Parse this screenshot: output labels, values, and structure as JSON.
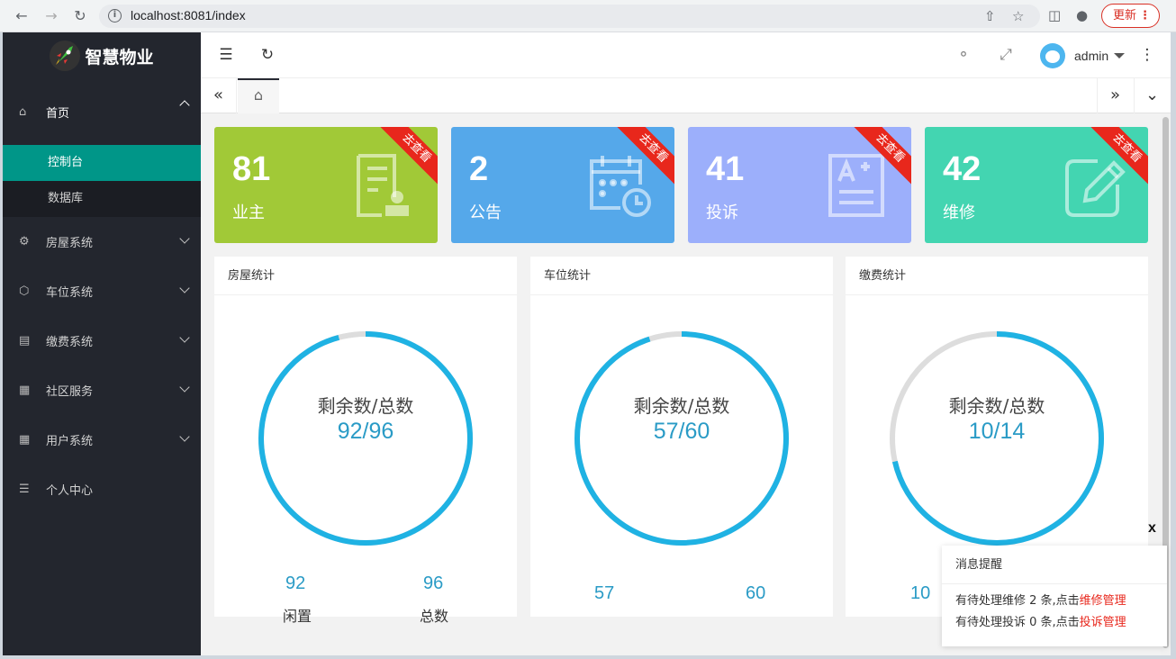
{
  "browser": {
    "url": "localhost:8081/index",
    "update_label": "更新"
  },
  "sidebar": {
    "app_name": "智慧物业",
    "home": {
      "label": "首页",
      "children": [
        "控制台",
        "数据库"
      ]
    },
    "items": [
      {
        "label": "房屋系统",
        "icon": "gear-icon"
      },
      {
        "label": "车位系统",
        "icon": "cube-icon"
      },
      {
        "label": "缴费系统",
        "icon": "barcode-icon"
      },
      {
        "label": "社区服务",
        "icon": "apps-icon"
      },
      {
        "label": "用户系统",
        "icon": "apps-icon"
      },
      {
        "label": "个人中心",
        "icon": "sliders-icon"
      }
    ]
  },
  "header": {
    "user": "admin"
  },
  "cards": [
    {
      "value": "81",
      "label": "业主",
      "ribbon": "去查看",
      "color": "#a1c937",
      "icon": "owner-document-icon"
    },
    {
      "value": "2",
      "label": "公告",
      "ribbon": "去查看",
      "color": "#55a8ea",
      "icon": "calendar-clock-icon"
    },
    {
      "value": "41",
      "label": "投诉",
      "ribbon": "去查看",
      "color": "#9caffb",
      "icon": "document-a-plus-icon"
    },
    {
      "value": "42",
      "label": "维修",
      "ribbon": "去查看",
      "color": "#43d5b1",
      "icon": "edit-pencil-icon"
    }
  ],
  "panels": [
    {
      "title": "房屋统计",
      "center_label": "剩余数/总数",
      "center_value": "92/96",
      "remaining": 92,
      "total": 96,
      "bottom_left_value": "92",
      "bottom_left_label": "闲置",
      "bottom_right_value": "96",
      "bottom_right_label": "总数"
    },
    {
      "title": "车位统计",
      "center_label": "剩余数/总数",
      "center_value": "57/60",
      "remaining": 57,
      "total": 60,
      "bottom_left_value": "57",
      "bottom_right_value": "60"
    },
    {
      "title": "缴费统计",
      "center_label": "剩余数/总数",
      "center_value": "10/14",
      "remaining": 10,
      "total": 14,
      "bottom_left_value": "10"
    }
  ],
  "toast": {
    "close": "x",
    "title": "消息提醒",
    "line1_text": "有待处理维修 2 条,点击",
    "line1_link": "维修管理",
    "line2_text": "有待处理投诉 0 条,点击",
    "line2_link": "投诉管理"
  },
  "colors": {
    "sidebar_bg": "#23262e",
    "active": "#009688",
    "ring": "#1fb2e3",
    "ring_bg": "#dddddd",
    "ribbon": "#e8271c"
  }
}
